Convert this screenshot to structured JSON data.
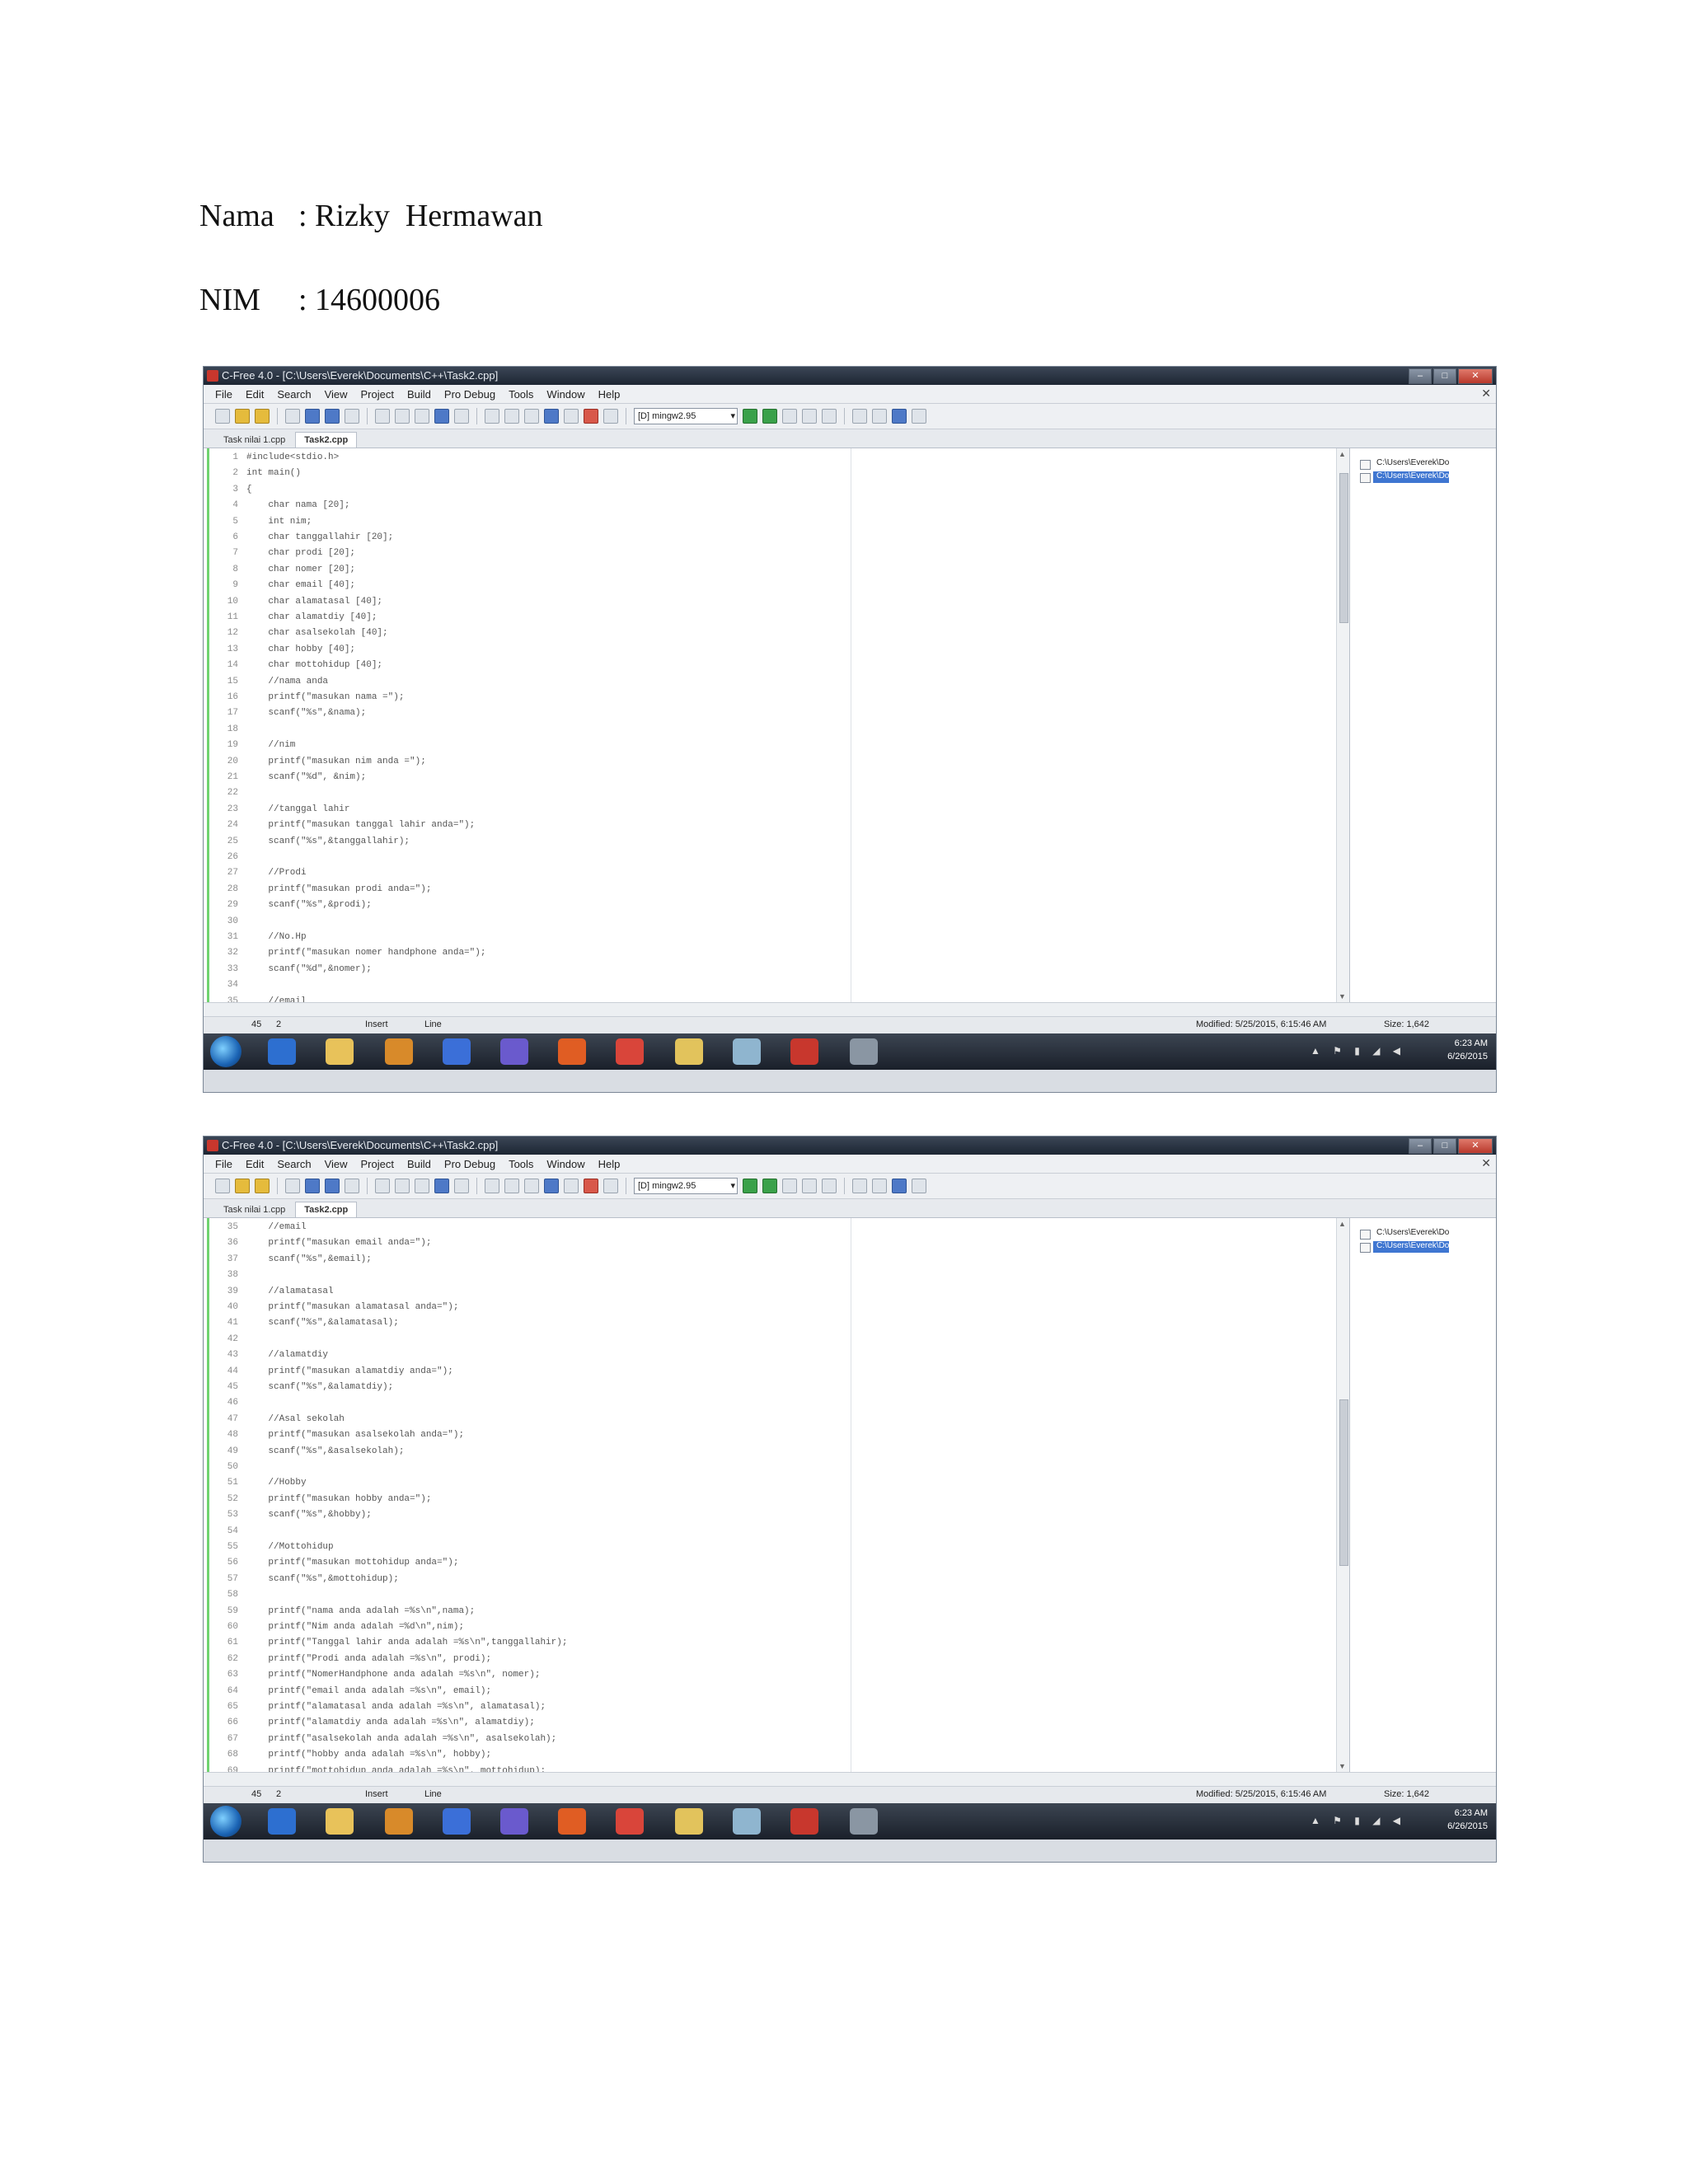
{
  "document": {
    "name_label": "Nama",
    "name_value": ": Rizky  Hermawan",
    "nim_label": "NIM",
    "nim_value": ": 14600006"
  },
  "ide": {
    "title": "C-Free 4.0 - [C:\\Users\\Everek\\Documents\\C++\\Task2.cpp]",
    "menu": [
      "File",
      "Edit",
      "Search",
      "View",
      "Project",
      "Build",
      "Pro Debug",
      "Tools",
      "Window",
      "Help"
    ],
    "compiler": "[D] mingw2.95",
    "tabs": [
      "Task nilai 1.cpp",
      "Task2.cpp"
    ],
    "active_tab": "Task2.cpp",
    "file_tree": [
      "C:\\Users\\Everek\\Do",
      "C:\\Users\\Everek\\Do"
    ],
    "status": {
      "pos_line": "45",
      "pos_col": "2",
      "mode": "Insert",
      "line_label": "Line",
      "modified": "Modified: 5/25/2015, 6:15:46 AM",
      "size": "Size: 1,642"
    },
    "clock_time": "6:23 AM",
    "clock_date": "6/26/2015"
  },
  "screenshot1": {
    "lines": [
      {
        "n": "1",
        "t": "#include<stdio.h>"
      },
      {
        "n": "2",
        "t": "int main()"
      },
      {
        "n": "3",
        "t": "{"
      },
      {
        "n": "4",
        "t": "    char nama [20];"
      },
      {
        "n": "5",
        "t": "    int nim;"
      },
      {
        "n": "6",
        "t": "    char tanggallahir [20];"
      },
      {
        "n": "7",
        "t": "    char prodi [20];"
      },
      {
        "n": "8",
        "t": "    char nomer [20];"
      },
      {
        "n": "9",
        "t": "    char email [40];"
      },
      {
        "n": "10",
        "t": "    char alamatasal [40];"
      },
      {
        "n": "11",
        "t": "    char alamatdiy [40];"
      },
      {
        "n": "12",
        "t": "    char asalsekolah [40];"
      },
      {
        "n": "13",
        "t": "    char hobby [40];"
      },
      {
        "n": "14",
        "t": "    char mottohidup [40];"
      },
      {
        "n": "15",
        "t": "    //nama anda"
      },
      {
        "n": "16",
        "t": "    printf(\"masukan nama =\");"
      },
      {
        "n": "17",
        "t": "    scanf(\"%s\",&nama);"
      },
      {
        "n": "18",
        "t": ""
      },
      {
        "n": "19",
        "t": "    //nim"
      },
      {
        "n": "20",
        "t": "    printf(\"masukan nim anda =\");"
      },
      {
        "n": "21",
        "t": "    scanf(\"%d\", &nim);"
      },
      {
        "n": "22",
        "t": ""
      },
      {
        "n": "23",
        "t": "    //tanggal lahir"
      },
      {
        "n": "24",
        "t": "    printf(\"masukan tanggal lahir anda=\");"
      },
      {
        "n": "25",
        "t": "    scanf(\"%s\",&tanggallahir);"
      },
      {
        "n": "26",
        "t": ""
      },
      {
        "n": "27",
        "t": "    //Prodi"
      },
      {
        "n": "28",
        "t": "    printf(\"masukan prodi anda=\");"
      },
      {
        "n": "29",
        "t": "    scanf(\"%s\",&prodi);"
      },
      {
        "n": "30",
        "t": ""
      },
      {
        "n": "31",
        "t": "    //No.Hp"
      },
      {
        "n": "32",
        "t": "    printf(\"masukan nomer handphone anda=\");"
      },
      {
        "n": "33",
        "t": "    scanf(\"%d\",&nomer);"
      },
      {
        "n": "34",
        "t": ""
      },
      {
        "n": "35",
        "t": "    //email"
      }
    ]
  },
  "screenshot2": {
    "lines": [
      {
        "n": "35",
        "t": "    //email"
      },
      {
        "n": "36",
        "t": "    printf(\"masukan email anda=\");"
      },
      {
        "n": "37",
        "t": "    scanf(\"%s\",&email);"
      },
      {
        "n": "38",
        "t": ""
      },
      {
        "n": "39",
        "t": "    //alamatasal"
      },
      {
        "n": "40",
        "t": "    printf(\"masukan alamatasal anda=\");"
      },
      {
        "n": "41",
        "t": "    scanf(\"%s\",&alamatasal);"
      },
      {
        "n": "42",
        "t": ""
      },
      {
        "n": "43",
        "t": "    //alamatdiy"
      },
      {
        "n": "44",
        "t": "    printf(\"masukan alamatdiy anda=\");"
      },
      {
        "n": "45",
        "t": "    scanf(\"%s\",&alamatdiy);"
      },
      {
        "n": "46",
        "t": ""
      },
      {
        "n": "47",
        "t": "    //Asal sekolah"
      },
      {
        "n": "48",
        "t": "    printf(\"masukan asalsekolah anda=\");"
      },
      {
        "n": "49",
        "t": "    scanf(\"%s\",&asalsekolah);"
      },
      {
        "n": "50",
        "t": ""
      },
      {
        "n": "51",
        "t": "    //Hobby"
      },
      {
        "n": "52",
        "t": "    printf(\"masukan hobby anda=\");"
      },
      {
        "n": "53",
        "t": "    scanf(\"%s\",&hobby);"
      },
      {
        "n": "54",
        "t": ""
      },
      {
        "n": "55",
        "t": "    //Mottohidup"
      },
      {
        "n": "56",
        "t": "    printf(\"masukan mottohidup anda=\");"
      },
      {
        "n": "57",
        "t": "    scanf(\"%s\",&mottohidup);"
      },
      {
        "n": "58",
        "t": ""
      },
      {
        "n": "59",
        "t": "    printf(\"nama anda adalah =%s\\n\",nama);"
      },
      {
        "n": "60",
        "t": "    printf(\"Nim anda adalah =%d\\n\",nim);"
      },
      {
        "n": "61",
        "t": "    printf(\"Tanggal lahir anda adalah =%s\\n\",tanggallahir);"
      },
      {
        "n": "62",
        "t": "    printf(\"Prodi anda adalah =%s\\n\", prodi);"
      },
      {
        "n": "63",
        "t": "    printf(\"NomerHandphone anda adalah =%s\\n\", nomer);"
      },
      {
        "n": "64",
        "t": "    printf(\"email anda adalah =%s\\n\", email);"
      },
      {
        "n": "65",
        "t": "    printf(\"alamatasal anda adalah =%s\\n\", alamatasal);"
      },
      {
        "n": "66",
        "t": "    printf(\"alamatdiy anda adalah =%s\\n\", alamatdiy);"
      },
      {
        "n": "67",
        "t": "    printf(\"asalsekolah anda adalah =%s\\n\", asalsekolah);"
      },
      {
        "n": "68",
        "t": "    printf(\"hobby anda adalah =%s\\n\", hobby);"
      },
      {
        "n": "69",
        "t": "    printf(\"mottohidup anda adalah =%s\\n\", mottohidup);"
      }
    ]
  }
}
